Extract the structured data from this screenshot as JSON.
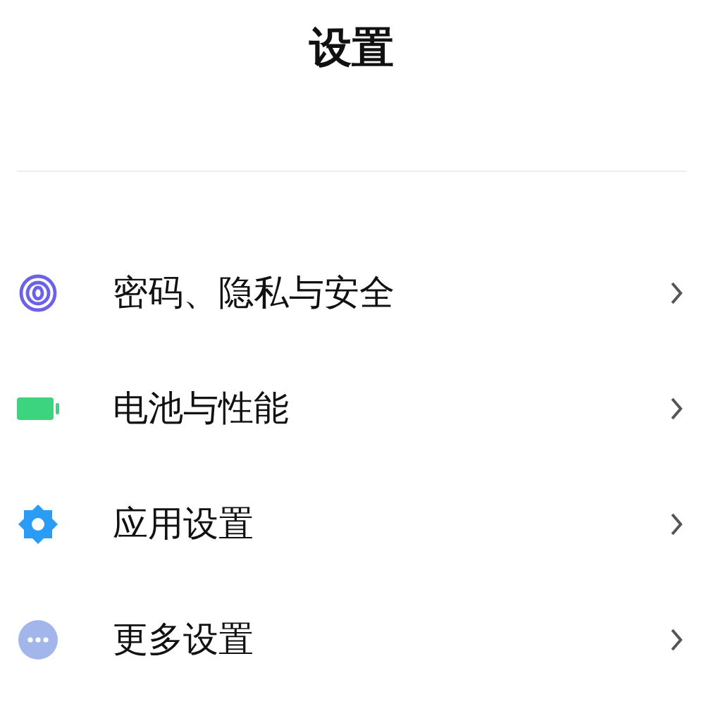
{
  "title": "设置",
  "items": [
    {
      "kind": "fingerprint",
      "label": "密码、隐私与安全"
    },
    {
      "kind": "battery",
      "label": "电池与性能"
    },
    {
      "kind": "gear",
      "label": "应用设置"
    },
    {
      "kind": "more",
      "label": "更多设置"
    }
  ]
}
